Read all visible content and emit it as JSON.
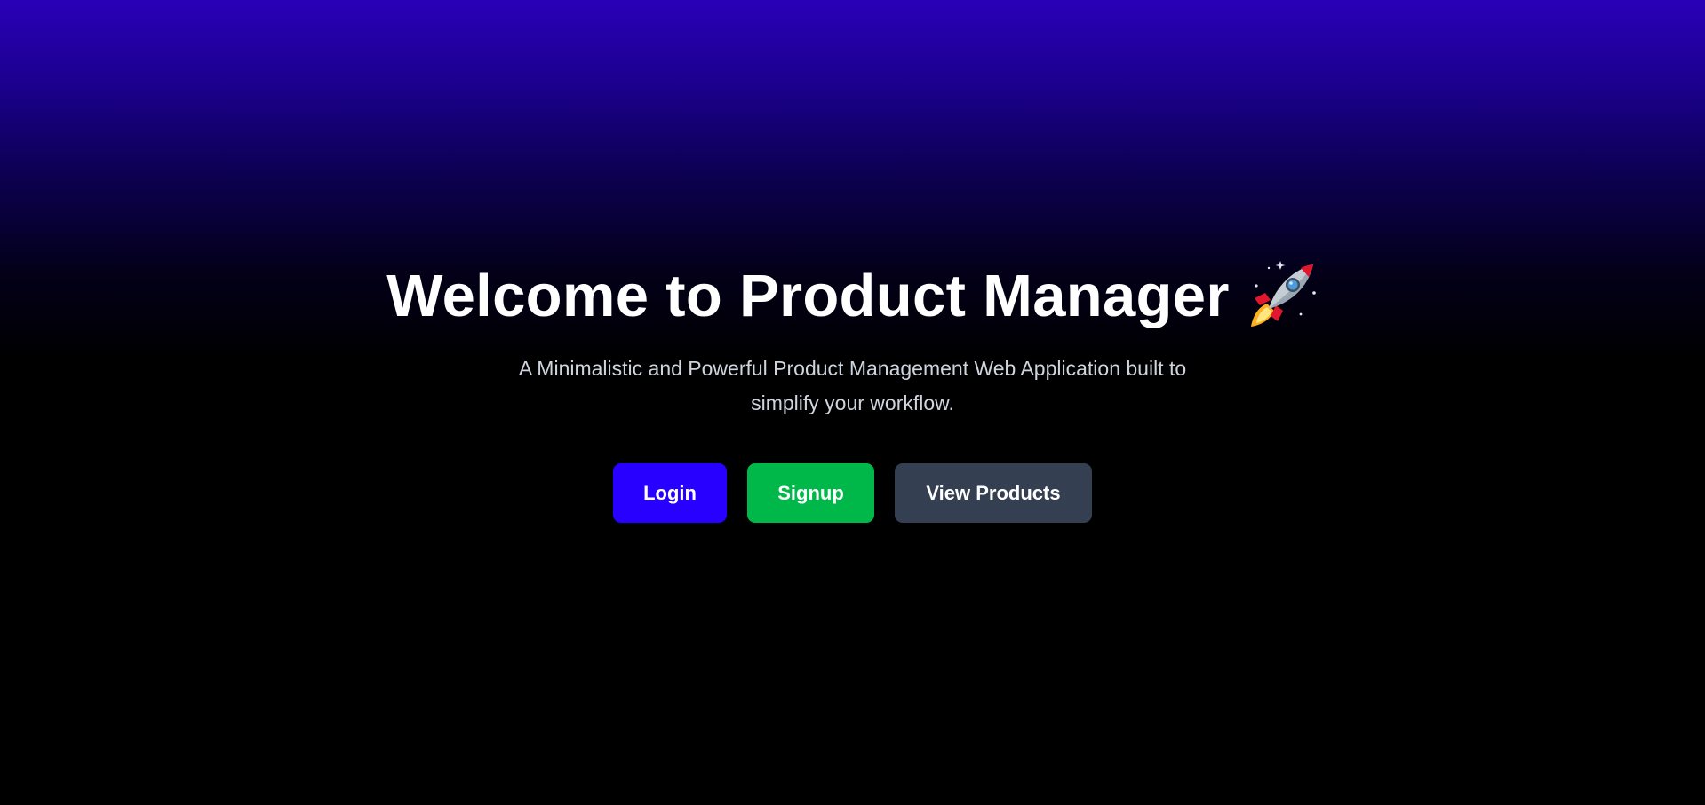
{
  "hero": {
    "title": "Welcome to Product Manager",
    "title_icon": "rocket-icon",
    "subtitle": "A Minimalistic and Powerful Product Management Web Application built to simplify your workflow."
  },
  "actions": {
    "login_label": "Login",
    "signup_label": "Signup",
    "view_products_label": "View Products"
  },
  "colors": {
    "background_top": "#2a00b8",
    "background_bottom": "#000000",
    "login": "#2700ff",
    "signup": "#00b84a",
    "view_products": "#353f52",
    "subtitle_text": "#cfd5de"
  }
}
